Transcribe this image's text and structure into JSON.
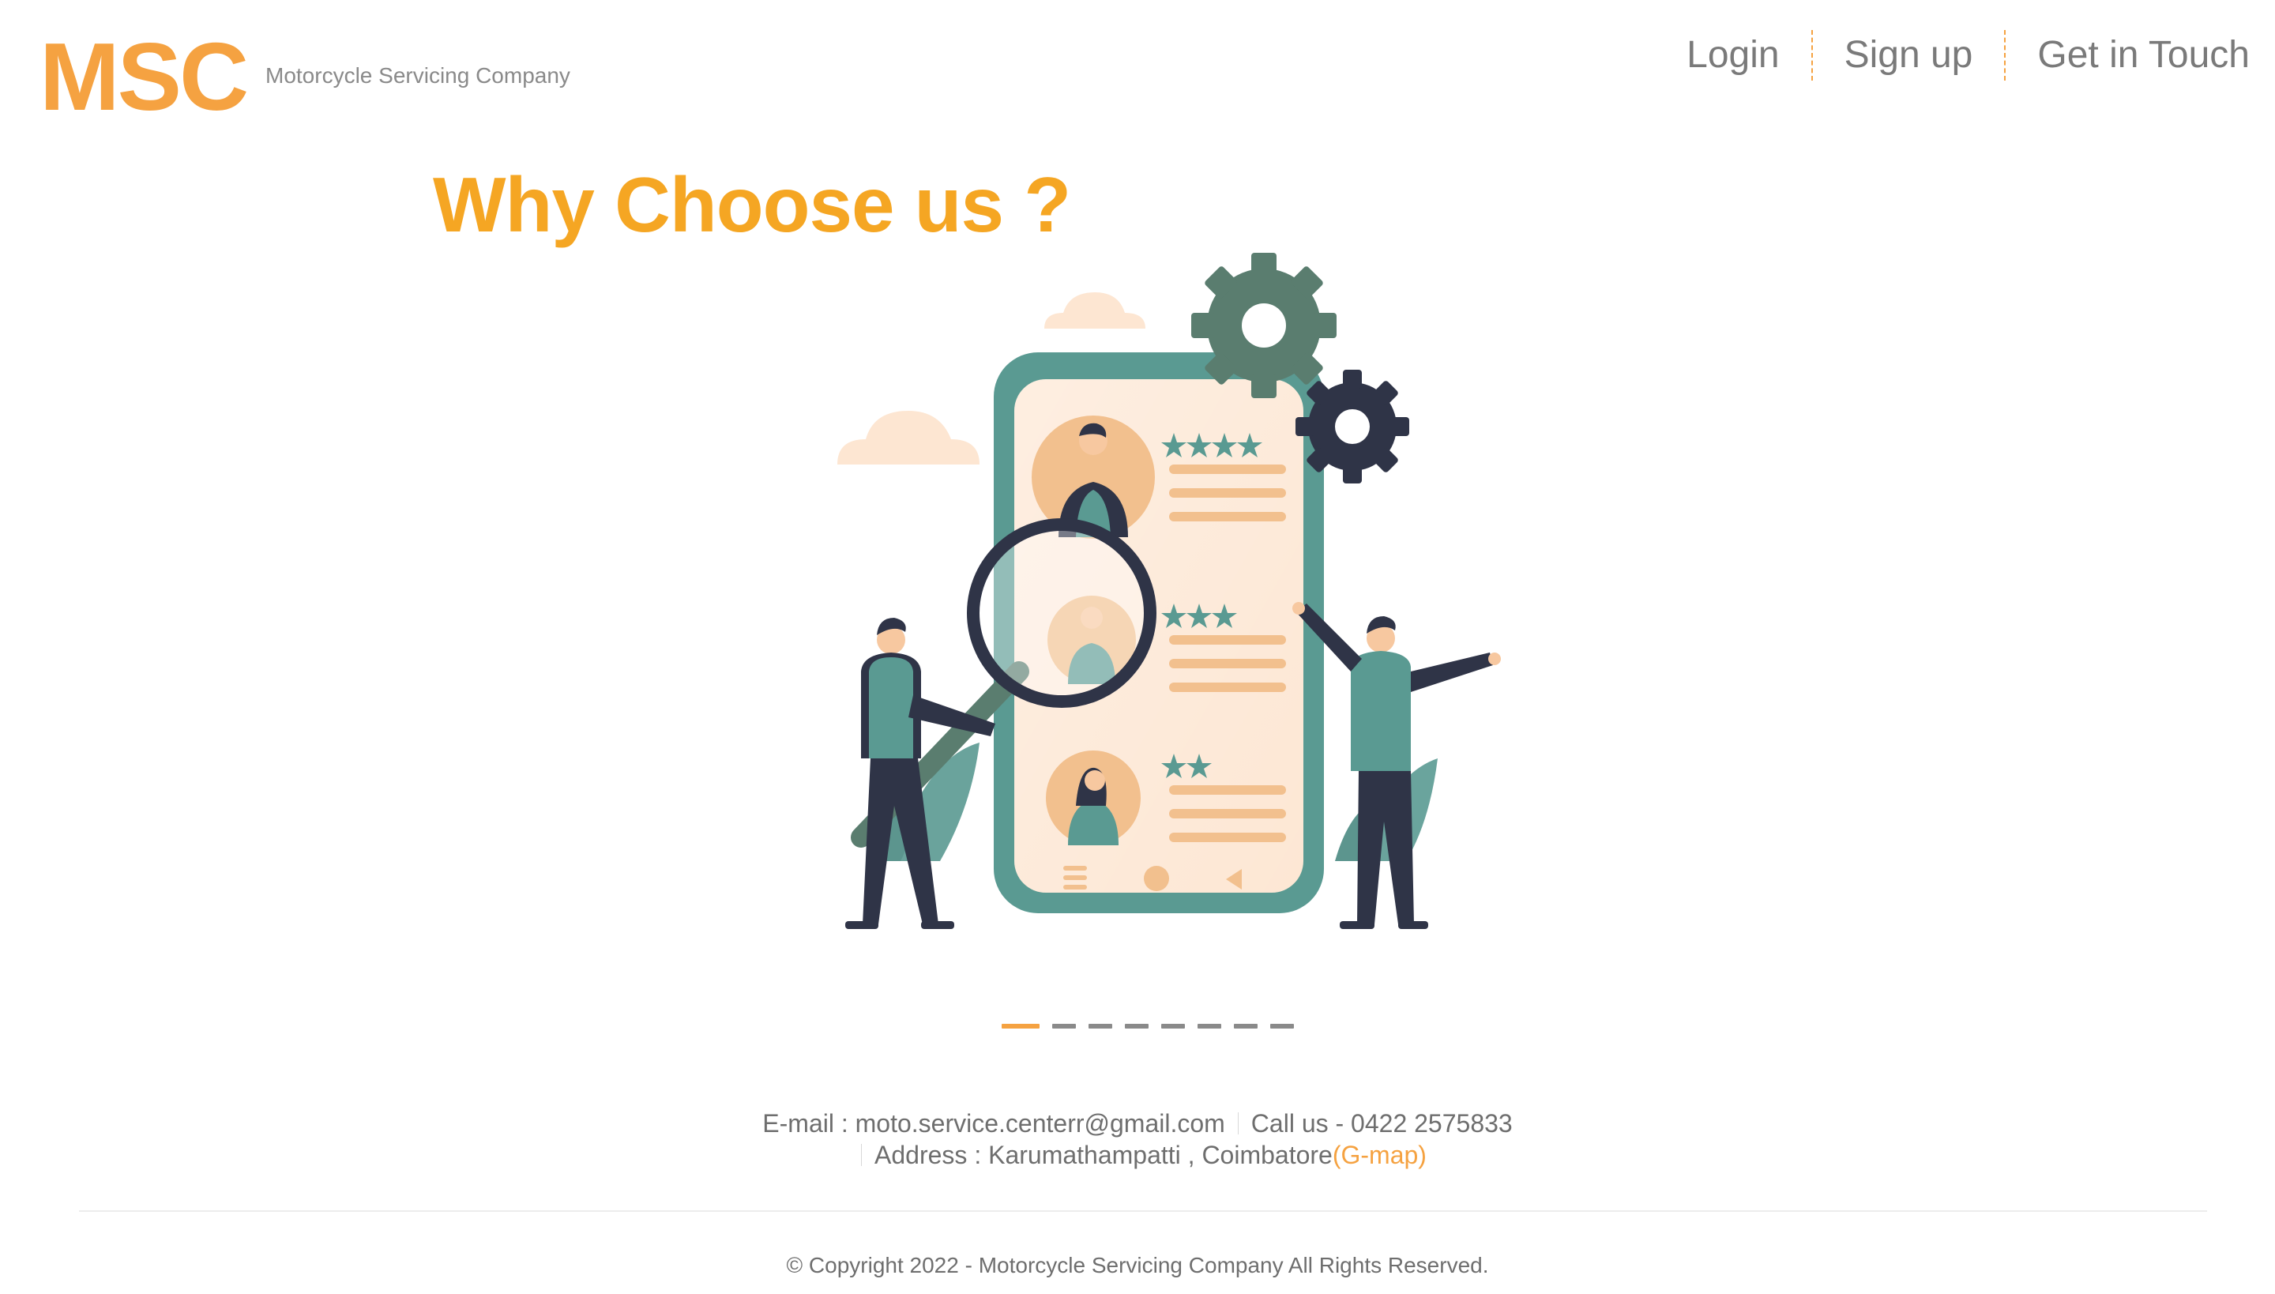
{
  "brand": {
    "logo": "MSC",
    "tagline": "Motorcycle Servicing Company"
  },
  "nav": {
    "login": "Login",
    "signup": "Sign up",
    "contact": "Get in Touch"
  },
  "hero": {
    "title": "Why Choose us ?",
    "illustration": "review-rating-illustration",
    "slide_count": 8,
    "active_slide": 1
  },
  "contact": {
    "email": "E-mail : moto.service.centerr@gmail.com",
    "phone": "Call us - 0422 2575833",
    "address": "Address : Karumathampatti , Coimbatore",
    "map_link": "(G-map)"
  },
  "footer": {
    "copyright": "© Copyright 2022 - Motorcycle Servicing Company All Rights Reserved."
  },
  "colors": {
    "accent": "#f5a241",
    "title": "#f5a623",
    "teal": "#5a9a92",
    "dark": "#2f3447",
    "peach": "#fde7d4"
  }
}
